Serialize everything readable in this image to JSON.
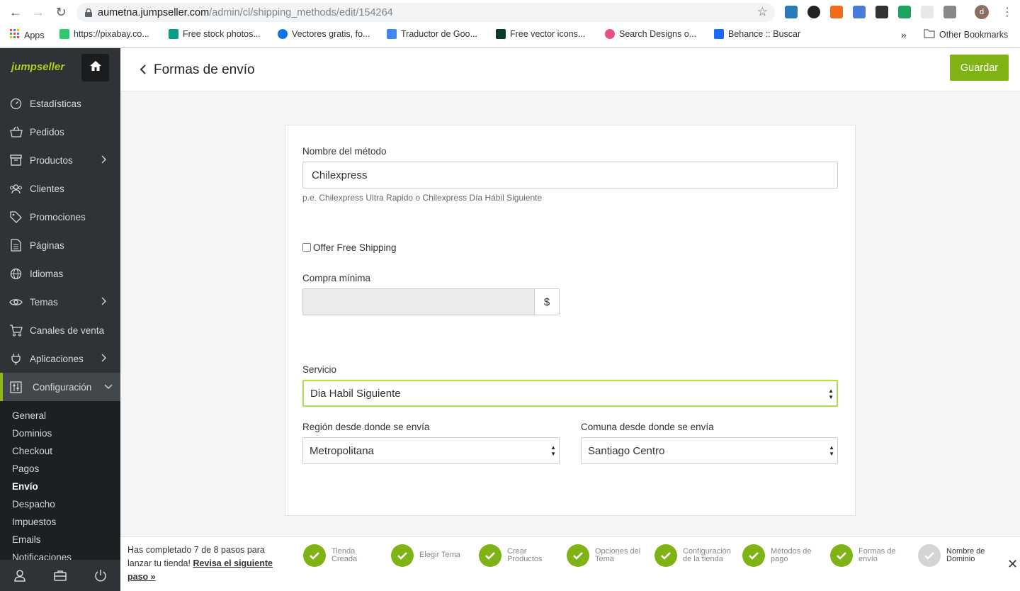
{
  "browser": {
    "url_domain": "aumetna.jumpseller.com",
    "url_path": "/admin/cl/shipping_methods/edit/154264",
    "bookmarks": [
      {
        "label": "Apps",
        "color": "#e44"
      },
      {
        "label": "https://pixabay.co...",
        "color": "#2ec66e"
      },
      {
        "label": "Free stock photos...",
        "color": "#05a081"
      },
      {
        "label": "Vectores gratis, fo...",
        "color": "#1273eb"
      },
      {
        "label": "Traductor de Goo...",
        "color": "#4285f4"
      },
      {
        "label": "Free vector icons...",
        "color": "#0c3b2e"
      },
      {
        "label": "Search Designs o...",
        "color": "#ea4c89"
      },
      {
        "label": "Behance :: Buscar",
        "color": "#1769ff"
      }
    ],
    "overflow": "»",
    "other_bookmarks": "Other Bookmarks",
    "profile_initial": "d"
  },
  "app": {
    "logo": "jumpseller",
    "nav": [
      {
        "label": "Estadísticas",
        "icon": "gauge-icon",
        "arrow": false
      },
      {
        "label": "Pedidos",
        "icon": "basket-icon",
        "arrow": false
      },
      {
        "label": "Productos",
        "icon": "box-icon",
        "arrow": true
      },
      {
        "label": "Clientes",
        "icon": "users-icon",
        "arrow": false
      },
      {
        "label": "Promociones",
        "icon": "tag-icon",
        "arrow": false
      },
      {
        "label": "Páginas",
        "icon": "page-icon",
        "arrow": false
      },
      {
        "label": "Idiomas",
        "icon": "globe-icon",
        "arrow": false
      },
      {
        "label": "Temas",
        "icon": "eye-icon",
        "arrow": true
      },
      {
        "label": "Canales de venta",
        "icon": "cart-icon",
        "arrow": false
      },
      {
        "label": "Aplicaciones",
        "icon": "plug-icon",
        "arrow": true
      },
      {
        "label": "Configuración",
        "icon": "settings-icon",
        "arrow": true
      }
    ],
    "submenu": [
      "General",
      "Dominios",
      "Checkout",
      "Pagos",
      "Envío",
      "Despacho",
      "Impuestos",
      "Emails",
      "Notificaciones"
    ],
    "submenu_current": "Envío"
  },
  "page": {
    "title": "Formas de envío",
    "save_label": "Guardar"
  },
  "form": {
    "name_label": "Nombre del método",
    "name_value": "Chilexpress",
    "name_hint": "p.e. Chilexpress Ultra Rapido o Chilexpress Día Hábil Siguiente",
    "free_shipping_label": "Offer Free Shipping",
    "free_shipping_checked": false,
    "min_purchase_label": "Compra mínima",
    "min_purchase_value": "",
    "currency": "$",
    "service_label": "Servicio",
    "service_value": "Dia Habil Siguiente",
    "region_label": "Región desde donde se envía",
    "region_value": "Metropolitana",
    "commune_label": "Comuna desde donde se envía",
    "commune_value": "Santiago Centro"
  },
  "progress": {
    "text": "Has completado 7 de 8 pasos para lanzar tu tienda!",
    "link": "Revisa el siguiente paso »",
    "steps": [
      {
        "label": "Tienda Creada",
        "done": true
      },
      {
        "label": "Elegir Tema",
        "done": true
      },
      {
        "label": "Crear Productos",
        "done": true
      },
      {
        "label": "Opciones del Tema",
        "done": true
      },
      {
        "label": "Configuración de la tienda",
        "done": true
      },
      {
        "label": "Métodos de pago",
        "done": true
      },
      {
        "label": "Formas de envío",
        "done": true
      },
      {
        "label": "Nombre de Dominio",
        "done": false
      }
    ]
  },
  "colors": {
    "accent": "#7fb315",
    "sidebar_bg": "#2f3337",
    "submenu_bg": "#1d2023"
  }
}
